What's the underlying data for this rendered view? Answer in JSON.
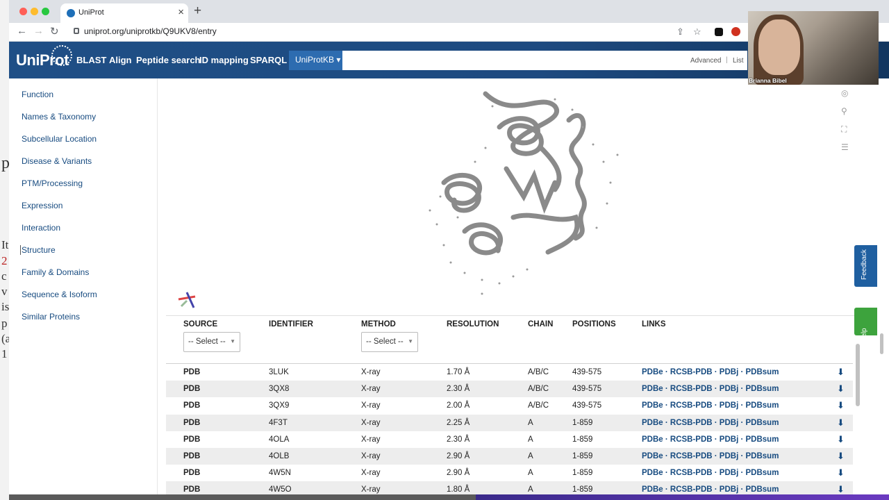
{
  "desktop": {
    "fragments": [
      "p",
      "It",
      "2",
      "c",
      "v",
      "is",
      "p",
      "(a",
      "1"
    ]
  },
  "browser": {
    "tab_title": "UniProt",
    "tab_close": "×",
    "new_tab": "+",
    "url": "uniprot.org/uniprotkb/Q9UKV8/entry",
    "back": "←",
    "forward": "→",
    "reload": "↻",
    "share": "⇪",
    "star": "☆"
  },
  "header": {
    "logo": "UniProt",
    "nav": [
      "BLAST",
      "Align",
      "Peptide search",
      "ID mapping",
      "SPARQL"
    ],
    "database_select": "UniProtKB ▾",
    "advanced": "Advanced",
    "separator": "|",
    "list": "List"
  },
  "sidebar": {
    "items": [
      {
        "label": "Function"
      },
      {
        "label": "Names & Taxonomy"
      },
      {
        "label": "Subcellular Location"
      },
      {
        "label": "Disease & Variants"
      },
      {
        "label": "PTM/Processing"
      },
      {
        "label": "Expression"
      },
      {
        "label": "Interaction"
      },
      {
        "label": "Structure",
        "active": true
      },
      {
        "label": "Family & Domains"
      },
      {
        "label": "Sequence & Isoform"
      },
      {
        "label": "Similar Proteins"
      }
    ]
  },
  "viewer": {
    "tools": [
      "reset-icon",
      "search-icon",
      "expand-icon",
      "settings-icon"
    ]
  },
  "table": {
    "columns": [
      "SOURCE",
      "IDENTIFIER",
      "METHOD",
      "RESOLUTION",
      "CHAIN",
      "POSITIONS",
      "LINKS"
    ],
    "source_filter": "-- Select --",
    "method_filter": "-- Select --",
    "rows": [
      {
        "source": "PDB",
        "id": "3LUK",
        "method": "X-ray",
        "resolution": "1.70 Å",
        "chain": "A/B/C",
        "positions": "439-575",
        "links": "PDBe · RCSB-PDB · PDBj · PDBsum"
      },
      {
        "source": "PDB",
        "id": "3QX8",
        "method": "X-ray",
        "resolution": "2.30 Å",
        "chain": "A/B/C",
        "positions": "439-575",
        "links": "PDBe · RCSB-PDB · PDBj · PDBsum"
      },
      {
        "source": "PDB",
        "id": "3QX9",
        "method": "X-ray",
        "resolution": "2.00 Å",
        "chain": "A/B/C",
        "positions": "439-575",
        "links": "PDBe · RCSB-PDB · PDBj · PDBsum"
      },
      {
        "source": "PDB",
        "id": "4F3T",
        "method": "X-ray",
        "resolution": "2.25 Å",
        "chain": "A",
        "positions": "1-859",
        "links": "PDBe · RCSB-PDB · PDBj · PDBsum"
      },
      {
        "source": "PDB",
        "id": "4OLA",
        "method": "X-ray",
        "resolution": "2.30 Å",
        "chain": "A",
        "positions": "1-859",
        "links": "PDBe · RCSB-PDB · PDBj · PDBsum"
      },
      {
        "source": "PDB",
        "id": "4OLB",
        "method": "X-ray",
        "resolution": "2.90 Å",
        "chain": "A",
        "positions": "1-859",
        "links": "PDBe · RCSB-PDB · PDBj · PDBsum"
      },
      {
        "source": "PDB",
        "id": "4W5N",
        "method": "X-ray",
        "resolution": "2.90 Å",
        "chain": "A",
        "positions": "1-859",
        "links": "PDBe · RCSB-PDB · PDBj · PDBsum"
      },
      {
        "source": "PDB",
        "id": "4W5O",
        "method": "X-ray",
        "resolution": "1.80 Å",
        "chain": "A",
        "positions": "1-859",
        "links": "PDBe · RCSB-PDB · PDBj · PDBsum"
      }
    ]
  },
  "widgets": {
    "feedback": "Feedback",
    "help": "Help"
  },
  "webcam": {
    "name": "Brianna Bibel"
  },
  "colors": {
    "header": "#1f4f86",
    "link": "#174b80",
    "feedback": "#1f5fa0",
    "help": "#3da33d"
  }
}
